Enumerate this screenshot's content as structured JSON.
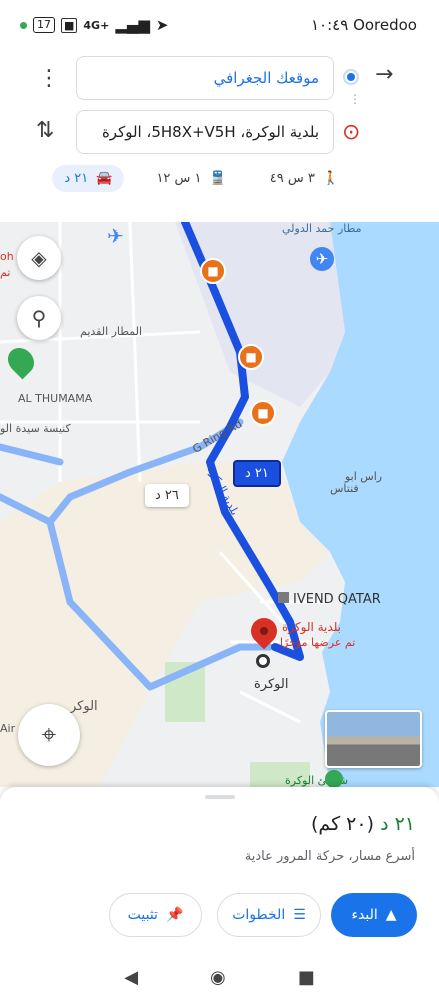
{
  "status_bar": {
    "battery": "17",
    "network": "4G+",
    "time": "١٠:٤٩",
    "carrier": "Ooredoo"
  },
  "route": {
    "origin": "موقعك الجغرافي",
    "destination": "بلدية الوكرة، 5H8X+V5H، الوكرة",
    "modes": [
      {
        "label": "٢١ د",
        "icon": "car-icon",
        "active": true
      },
      {
        "label": "١ س ١٢",
        "icon": "transit-icon",
        "active": false
      },
      {
        "label": "٣ س ٤٩",
        "icon": "walk-icon",
        "active": false
      }
    ]
  },
  "map": {
    "labels": {
      "airport": "مطار حمد الدولي",
      "old_airport": "المطار القديم",
      "thumama": "AL THUMAMA",
      "church": "كنيسة سيدة الو",
      "ring_road": "G Ring Rd",
      "ras_abu": "راس ابو",
      "fontas": "فنتاس",
      "ivend": "IVEND QATAR",
      "wakra": "الوكرة",
      "beach": "شاطئ الوكرة",
      "wakrah_street": "الوكر",
      "air_st": "Air S",
      "oh": "oh",
      "tm": "تم"
    },
    "road_label_main": "بلدية الوكرة",
    "destination_pin": {
      "title": "بلدية الوكرة",
      "subtitle": "تم عرضها مؤخرًا"
    },
    "route_bubble_primary": "٢١ د",
    "route_bubble_alt": "٢٦ د"
  },
  "sheet": {
    "summary_time": "٢١ د",
    "summary_distance": "(٢٠ كم)",
    "description": "أسرع مسار، حركة المرور عادية",
    "buttons": {
      "start": "البدء",
      "steps": "الخطوات",
      "pin": "تثبيت"
    }
  },
  "colors": {
    "accent": "#1a73e8",
    "route": "#1a4fe0",
    "green_time": "#188038",
    "water": "#aadaff"
  }
}
